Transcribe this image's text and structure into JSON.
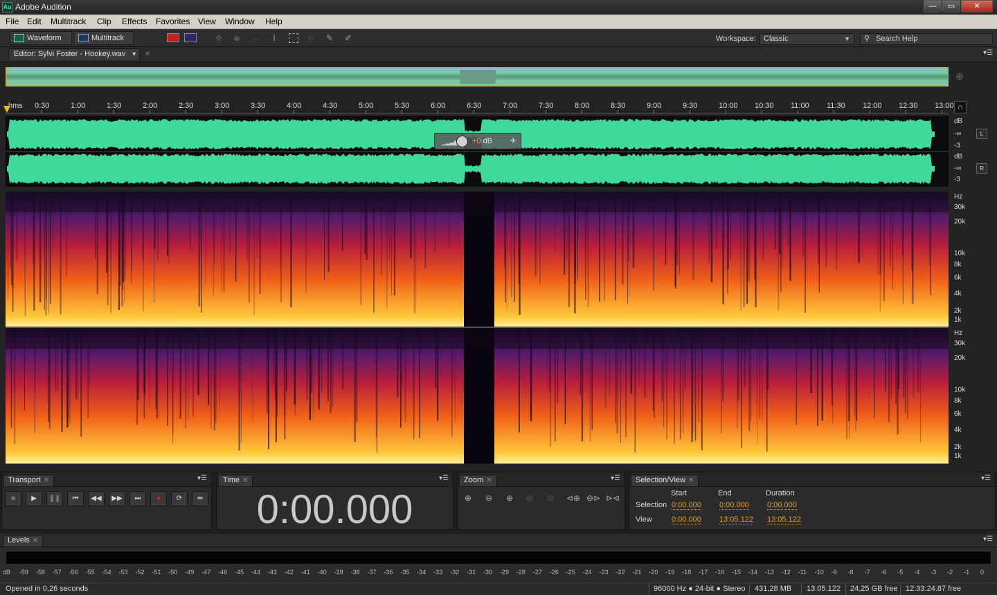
{
  "window": {
    "icon_label": "Au",
    "title": "Adobe Audition",
    "minimize": "—",
    "maximize": "▭",
    "close": "✕"
  },
  "menu": [
    "File",
    "Edit",
    "Multitrack",
    "Clip",
    "Effects",
    "Favorites",
    "View",
    "Window",
    "Help"
  ],
  "toolbar": {
    "waveform_label": "Waveform",
    "multitrack_label": "Multitrack",
    "workspace_label": "Workspace:",
    "workspace_value": "Classic",
    "search_placeholder": "Search Help"
  },
  "editor": {
    "tab_label": "Editor: Sylvi Foster - Hookey.wav"
  },
  "ruler": {
    "unit": "hms",
    "labels": [
      "0:30",
      "1:00",
      "1:30",
      "2:00",
      "2:30",
      "3:00",
      "3:30",
      "4:00",
      "4:30",
      "5:00",
      "5:30",
      "6:00",
      "6:30",
      "7:00",
      "7:30",
      "8:00",
      "8:30",
      "9:00",
      "9:30",
      "10:00",
      "10:30",
      "11:00",
      "11:30",
      "12:00",
      "12:30",
      "13:00"
    ]
  },
  "waveform": {
    "db_labels_left": [
      "dB",
      "-∞",
      "-3"
    ],
    "db_labels_right": [
      "dB",
      "-∞",
      "-3"
    ],
    "channel_left": "L",
    "channel_right": "R",
    "color": "#3fd99a"
  },
  "hud": {
    "value": "+0",
    "unit": "dB"
  },
  "spectral": {
    "labels": [
      "Hz",
      "30k",
      "20k",
      "10k",
      "8k",
      "6k",
      "4k",
      "2k",
      "1k"
    ]
  },
  "transport": {
    "title": "Transport"
  },
  "time": {
    "title": "Time",
    "display": "0:00.000"
  },
  "zoom": {
    "title": "Zoom"
  },
  "selection_view": {
    "title": "Selection/View",
    "col_start": "Start",
    "col_end": "End",
    "col_duration": "Duration",
    "row_selection": "Selection",
    "row_view": "View",
    "sel_start": "0:00.000",
    "sel_end": "0:00.000",
    "sel_duration": "0:00.000",
    "view_start": "0:00.000",
    "view_end": "13:05.122",
    "view_duration": "13:05.122"
  },
  "levels": {
    "title": "Levels",
    "scale": [
      "dB",
      "-59",
      "-58",
      "-57",
      "-56",
      "-55",
      "-54",
      "-53",
      "-52",
      "-51",
      "-50",
      "-49",
      "-47",
      "-46",
      "-45",
      "-44",
      "-43",
      "-42",
      "-41",
      "-40",
      "-39",
      "-38",
      "-37",
      "-36",
      "-35",
      "-34",
      "-33",
      "-32",
      "-31",
      "-30",
      "-29",
      "-28",
      "-27",
      "-26",
      "-25",
      "-24",
      "-23",
      "-22",
      "-21",
      "-20",
      "-19",
      "-18",
      "-17",
      "-16",
      "-15",
      "-14",
      "-13",
      "-12",
      "-11",
      "-10",
      "-9",
      "-8",
      "-7",
      "-6",
      "-5",
      "-4",
      "-3",
      "-2",
      "-1",
      "0"
    ]
  },
  "status": {
    "message": "Opened in 0,26 seconds",
    "format": "96000 Hz ● 24-bit ● Stereo",
    "size": "431,28 MB",
    "duration": "13:05.122",
    "free": "24,25 GB free",
    "free_time": "12:33:24.87 free"
  },
  "colors": {
    "accent": "#e0a020",
    "waveform": "#3fd99a",
    "spectrum_hot": "#ffd24a",
    "spectrum_mid": "#e2401a",
    "spectrum_low": "#3a1250"
  }
}
